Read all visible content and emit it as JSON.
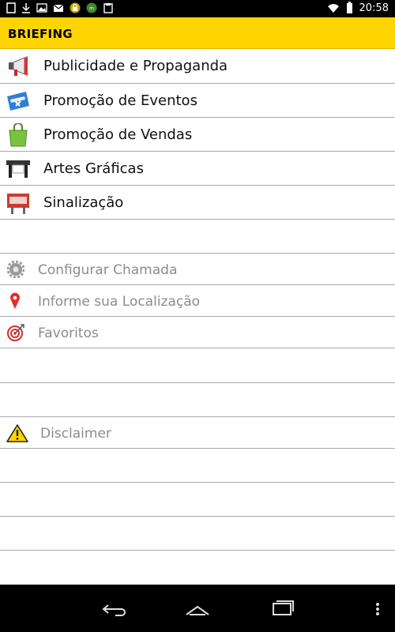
{
  "status_bar": {
    "time": "20:58",
    "icons_left": [
      "tablet-icon",
      "download-icon",
      "image-icon",
      "mail-icon",
      "lock-icon",
      "app-icon",
      "clipboard-icon"
    ],
    "icons_right": [
      "wifi-icon",
      "battery-icon"
    ]
  },
  "app_bar": {
    "title": "BRIEFING",
    "accent": "#ffd500"
  },
  "menu": {
    "items": [
      {
        "label": "Publicidade e Propaganda",
        "icon": "megaphone-icon"
      },
      {
        "label": "Promoção de Eventos",
        "icon": "ticket-icon"
      },
      {
        "label": "Promoção de Vendas",
        "icon": "shopping-bag-icon"
      },
      {
        "label": "Artes Gráficas",
        "icon": "printer-icon"
      },
      {
        "label": "Sinalização",
        "icon": "sign-icon"
      }
    ]
  },
  "settings": {
    "items": [
      {
        "label": "Configurar Chamada",
        "icon": "gear-icon"
      },
      {
        "label": "Informe sua Localização",
        "icon": "location-pin-icon"
      },
      {
        "label": "Favoritos",
        "icon": "target-icon"
      }
    ]
  },
  "disclaimer": {
    "label": "Disclaimer",
    "icon": "warning-icon"
  },
  "nav_bar": {
    "buttons": [
      "back-icon",
      "home-icon",
      "recent-apps-icon",
      "overflow-menu-icon"
    ]
  }
}
